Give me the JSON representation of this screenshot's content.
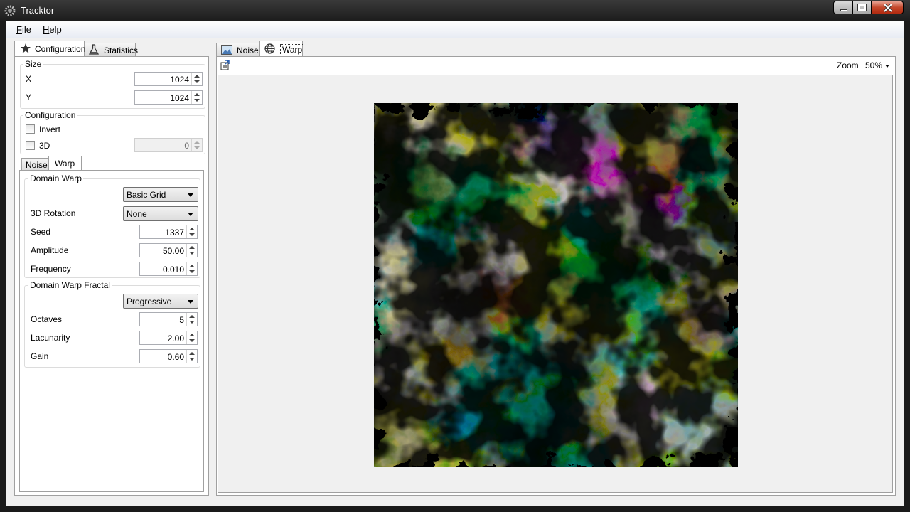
{
  "window": {
    "title": "Tracktor"
  },
  "menu": {
    "file": "File",
    "help": "Help"
  },
  "left_tabs": {
    "configuration": "Configuration",
    "statistics": "Statistics"
  },
  "size_group": {
    "title": "Size",
    "x_label": "X",
    "x_value": "1024",
    "y_label": "Y",
    "y_value": "1024"
  },
  "config_group": {
    "title": "Configuration",
    "invert_label": "Invert",
    "invert_checked": false,
    "threed_label": "3D",
    "threed_checked": false,
    "threed_value": "0"
  },
  "sub_tabs": {
    "noise": "Noise",
    "warp": "Warp"
  },
  "domain_warp": {
    "title": "Domain Warp",
    "type_value": "Basic Grid",
    "rotation_label": "3D Rotation",
    "rotation_value": "None",
    "seed_label": "Seed",
    "seed_value": "1337",
    "amplitude_label": "Amplitude",
    "amplitude_value": "50.00",
    "frequency_label": "Frequency",
    "frequency_value": "0.010"
  },
  "domain_warp_fractal": {
    "title": "Domain Warp Fractal",
    "type_value": "Progressive",
    "octaves_label": "Octaves",
    "octaves_value": "5",
    "lacunarity_label": "Lacunarity",
    "lacunarity_value": "2.00",
    "gain_label": "Gain",
    "gain_value": "0.60"
  },
  "preview_tabs": {
    "noise": "Noise",
    "warp": "Warp"
  },
  "toolbar": {
    "zoom_label": "Zoom",
    "zoom_value": "50%"
  },
  "colors": {
    "titlebar": "#1c1c1c",
    "close": "#c4472b",
    "panel": "#f0f0f0",
    "canvas": "#000000"
  }
}
